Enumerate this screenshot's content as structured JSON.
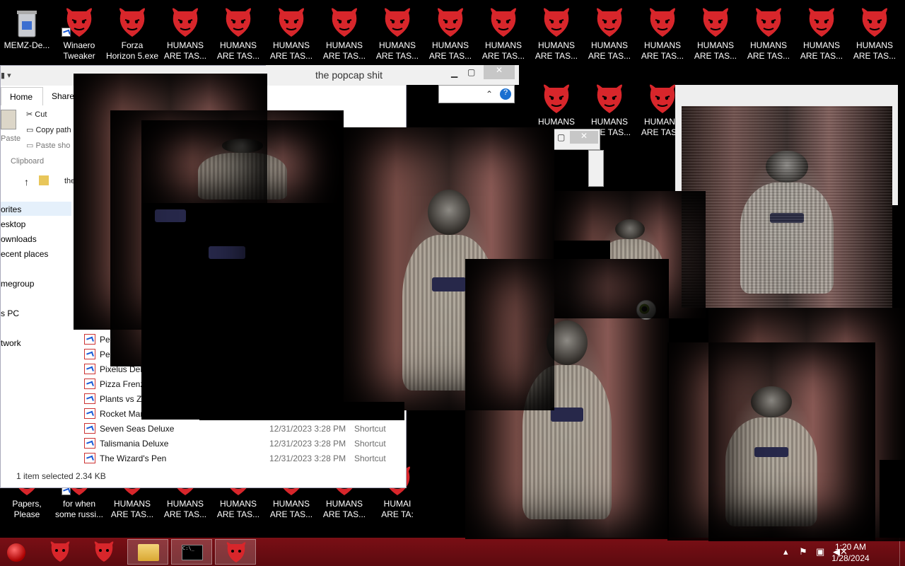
{
  "desktop_icons_top": [
    {
      "name": "recycle-bin",
      "label": "MEMZ-De..."
    },
    {
      "name": "winaero",
      "label": "Winaero\nTweaker"
    },
    {
      "name": "forza",
      "label": "Forza\nHorizon 5.exe"
    },
    {
      "name": "humans",
      "label": "HUMANS\nARE TAS..."
    }
  ],
  "desktop_icons_bottom": [
    {
      "label": "Papers,\nPlease"
    },
    {
      "label": "for when\nsome russi..."
    },
    {
      "label": "HUMANS\nARE TAS..."
    },
    {
      "label": "HUMAI\nARE TA:"
    }
  ],
  "explorer": {
    "title": "the popcap shit",
    "tabs": {
      "home": "Home",
      "share": "Share"
    },
    "ribbon": {
      "cut": "Cut",
      "copy_path": "Copy path",
      "paste": "Paste",
      "paste_shortcut": "Paste sho",
      "group": "Clipboard"
    },
    "address": "the",
    "nav": [
      "orites",
      "esktop",
      "ownloads",
      "ecent places",
      "megroup",
      "s PC",
      "twork"
    ],
    "files": [
      {
        "name": "Peg",
        "date": "",
        "type": ""
      },
      {
        "name": "Peg",
        "date": "",
        "type": ""
      },
      {
        "name": "Pixelus Delu",
        "date": "",
        "type": ""
      },
      {
        "name": "Pizza Frenzy",
        "date": "",
        "type": ""
      },
      {
        "name": "Plants vs Zo",
        "date": "",
        "type": ""
      },
      {
        "name": "Rocket Mania Deluxe",
        "date": "",
        "type": ""
      },
      {
        "name": "Seven Seas Deluxe",
        "date": "12/31/2023 3:28 PM",
        "type": "Shortcut"
      },
      {
        "name": "Talismania Deluxe",
        "date": "12/31/2023 3:28 PM",
        "type": "Shortcut"
      },
      {
        "name": "The Wizard's Pen",
        "date": "12/31/2023 3:28 PM",
        "type": "Shortcut"
      }
    ],
    "status": "1 item selected  2.34 KB"
  },
  "taskbar": {
    "time": "1:20 AM",
    "date": "1/28/2024"
  },
  "colors": {
    "taskbar": "#6b0c12",
    "devil": "#d8262b",
    "accent": "#1a5ad6"
  }
}
